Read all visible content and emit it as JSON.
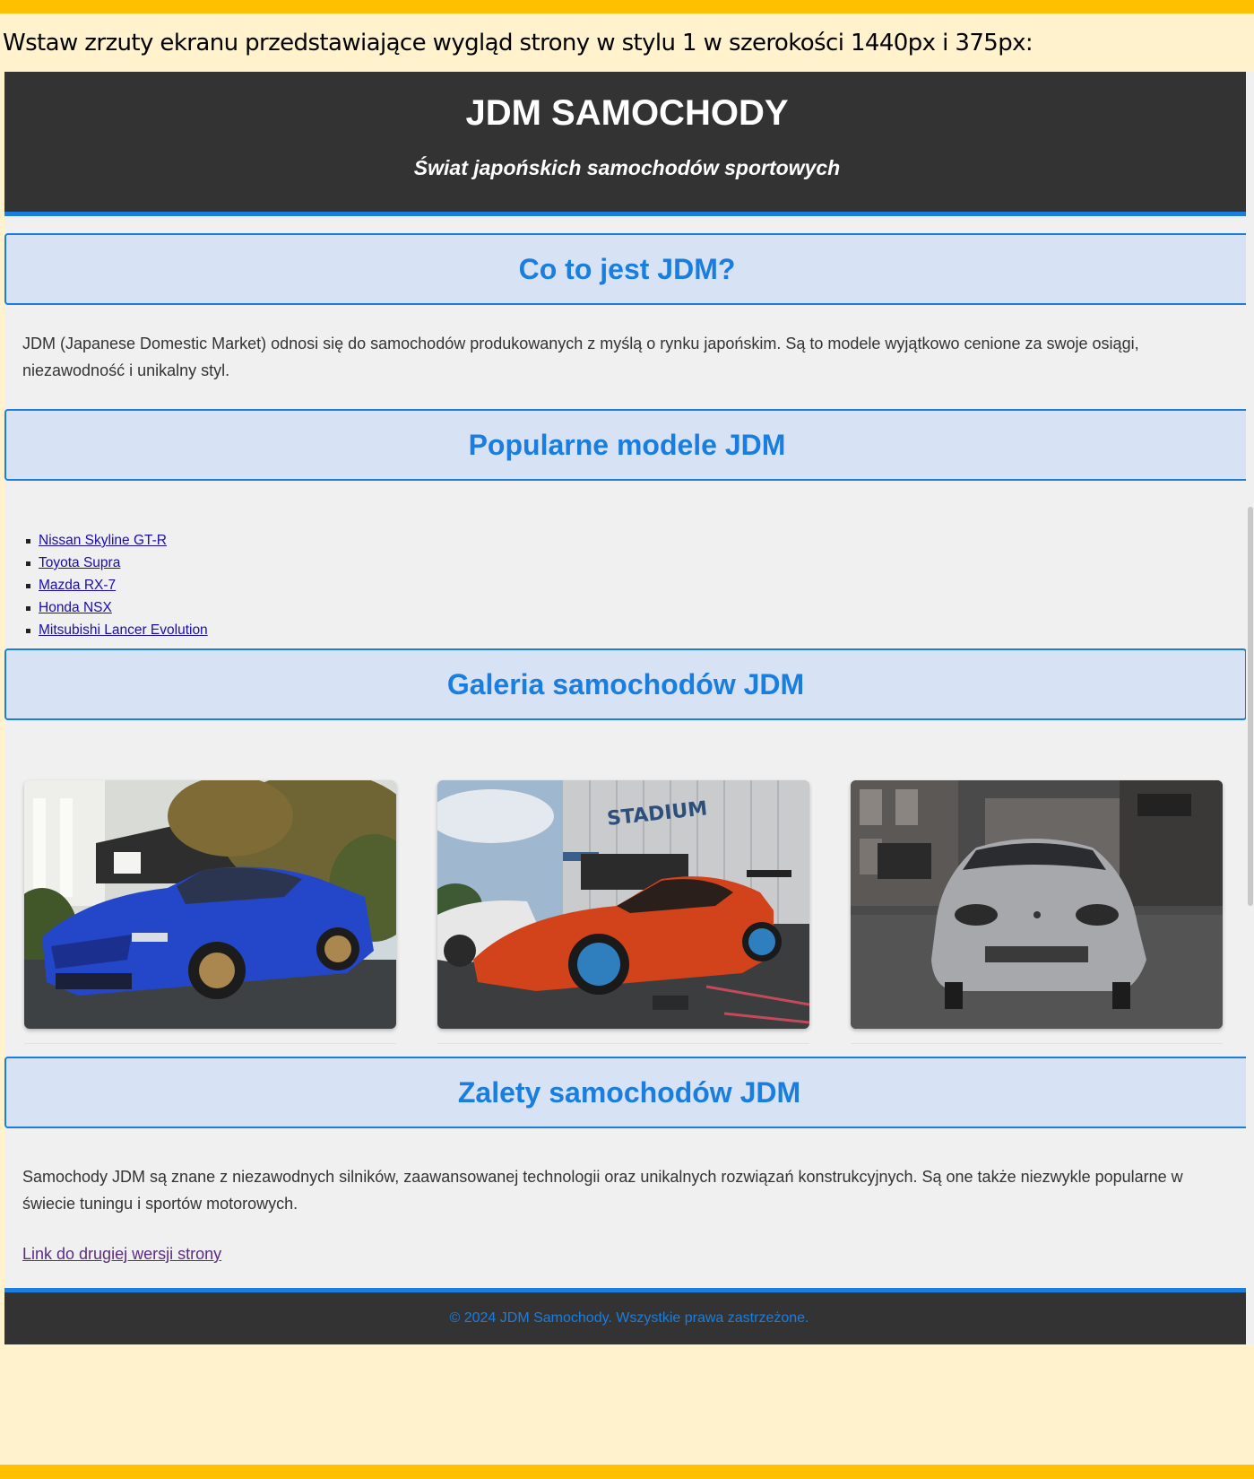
{
  "instruction": "Wstaw zrzuty ekranu przedstawiające wygląd strony w stylu 1 w szerokości 1440px i 375px:",
  "header": {
    "title": "JDM SAMOCHODY",
    "subtitle": "Świat japońskich samochodów sportowych"
  },
  "sections": {
    "what": {
      "title": "Co to jest JDM?",
      "text": "JDM (Japanese Domestic Market) odnosi się do samochodów produkowanych z myślą o rynku japońskim. Są to modele wyjątkowo cenione za swoje osiągi, niezawodność i unikalny styl."
    },
    "models": {
      "title": "Popularne modele JDM",
      "items": [
        "Nissan Skyline GT-R",
        "Toyota Supra",
        "Mazda RX-7",
        "Honda NSX",
        "Mitsubishi Lancer Evolution"
      ]
    },
    "gallery": {
      "title": "Galeria samochodów JDM",
      "sign_text": "STADIUM"
    },
    "advantages": {
      "title": "Zalety samochodów JDM",
      "text": "Samochody JDM są znane z niezawodnych silników, zaawansowanej technologii oraz unikalnych rozwiązań konstrukcyjnych. Są one także niezwykle popularne w świecie tuningu i sportów motorowych."
    }
  },
  "second_version_link": "Link do drugiej wersji strony",
  "footer": {
    "text": "© 2024 JDM Samochody. Wszystkie prawa zastrzeżone."
  },
  "colors": {
    "accent": "#1a7de0",
    "header_bg": "#333333",
    "page_bg": "#f0f0f0",
    "doc_bg": "#fff2cc",
    "doc_bar": "#ffc000"
  }
}
